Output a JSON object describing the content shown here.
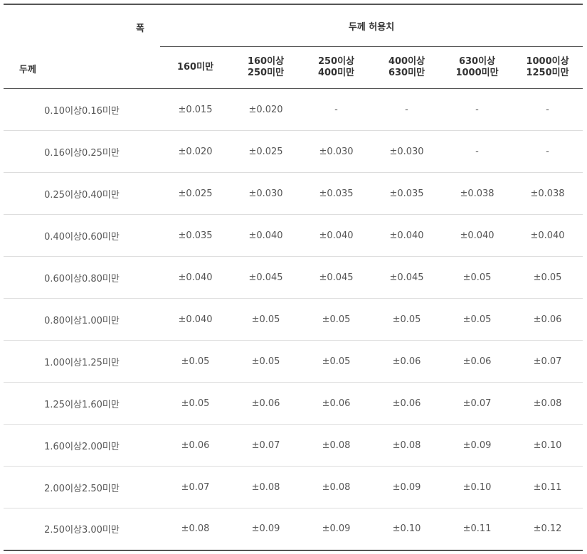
{
  "table": {
    "width_label": "폭",
    "thickness_label": "두께",
    "group_header": "두께 허용치",
    "columns": [
      {
        "line1": "160미만",
        "line2": ""
      },
      {
        "line1": "160이상",
        "line2": "250미만"
      },
      {
        "line1": "250이상",
        "line2": "400미만"
      },
      {
        "line1": "400이상",
        "line2": "630미만"
      },
      {
        "line1": "630이상",
        "line2": "1000미만"
      },
      {
        "line1": "1000이상",
        "line2": "1250미만"
      }
    ],
    "rows": [
      {
        "range": "0.10이상0.16미만",
        "values": [
          "±0.015",
          "±0.020",
          "-",
          "-",
          "-",
          "-"
        ]
      },
      {
        "range": "0.16이상0.25미만",
        "values": [
          "±0.020",
          "±0.025",
          "±0.030",
          "±0.030",
          "-",
          "-"
        ]
      },
      {
        "range": "0.25이상0.40미만",
        "values": [
          "±0.025",
          "±0.030",
          "±0.035",
          "±0.035",
          "±0.038",
          "±0.038"
        ]
      },
      {
        "range": "0.40이상0.60미만",
        "values": [
          "±0.035",
          "±0.040",
          "±0.040",
          "±0.040",
          "±0.040",
          "±0.040"
        ]
      },
      {
        "range": "0.60이상0.80미만",
        "values": [
          "±0.040",
          "±0.045",
          "±0.045",
          "±0.045",
          "±0.05",
          "±0.05"
        ]
      },
      {
        "range": "0.80이상1.00미만",
        "values": [
          "±0.040",
          "±0.05",
          "±0.05",
          "±0.05",
          "±0.05",
          "±0.06"
        ]
      },
      {
        "range": "1.00이상1.25미만",
        "values": [
          "±0.05",
          "±0.05",
          "±0.05",
          "±0.06",
          "±0.06",
          "±0.07"
        ]
      },
      {
        "range": "1.25이상1.60미만",
        "values": [
          "±0.05",
          "±0.06",
          "±0.06",
          "±0.06",
          "±0.07",
          "±0.08"
        ]
      },
      {
        "range": "1.60이상2.00미만",
        "values": [
          "±0.06",
          "±0.07",
          "±0.08",
          "±0.08",
          "±0.09",
          "±0.10"
        ]
      },
      {
        "range": "2.00이상2.50미만",
        "values": [
          "±0.07",
          "±0.08",
          "±0.08",
          "±0.09",
          "±0.10",
          "±0.11"
        ]
      },
      {
        "range": "2.50이상3.00미만",
        "values": [
          "±0.08",
          "±0.09",
          "±0.09",
          "±0.10",
          "±0.11",
          "±0.12"
        ]
      }
    ]
  }
}
